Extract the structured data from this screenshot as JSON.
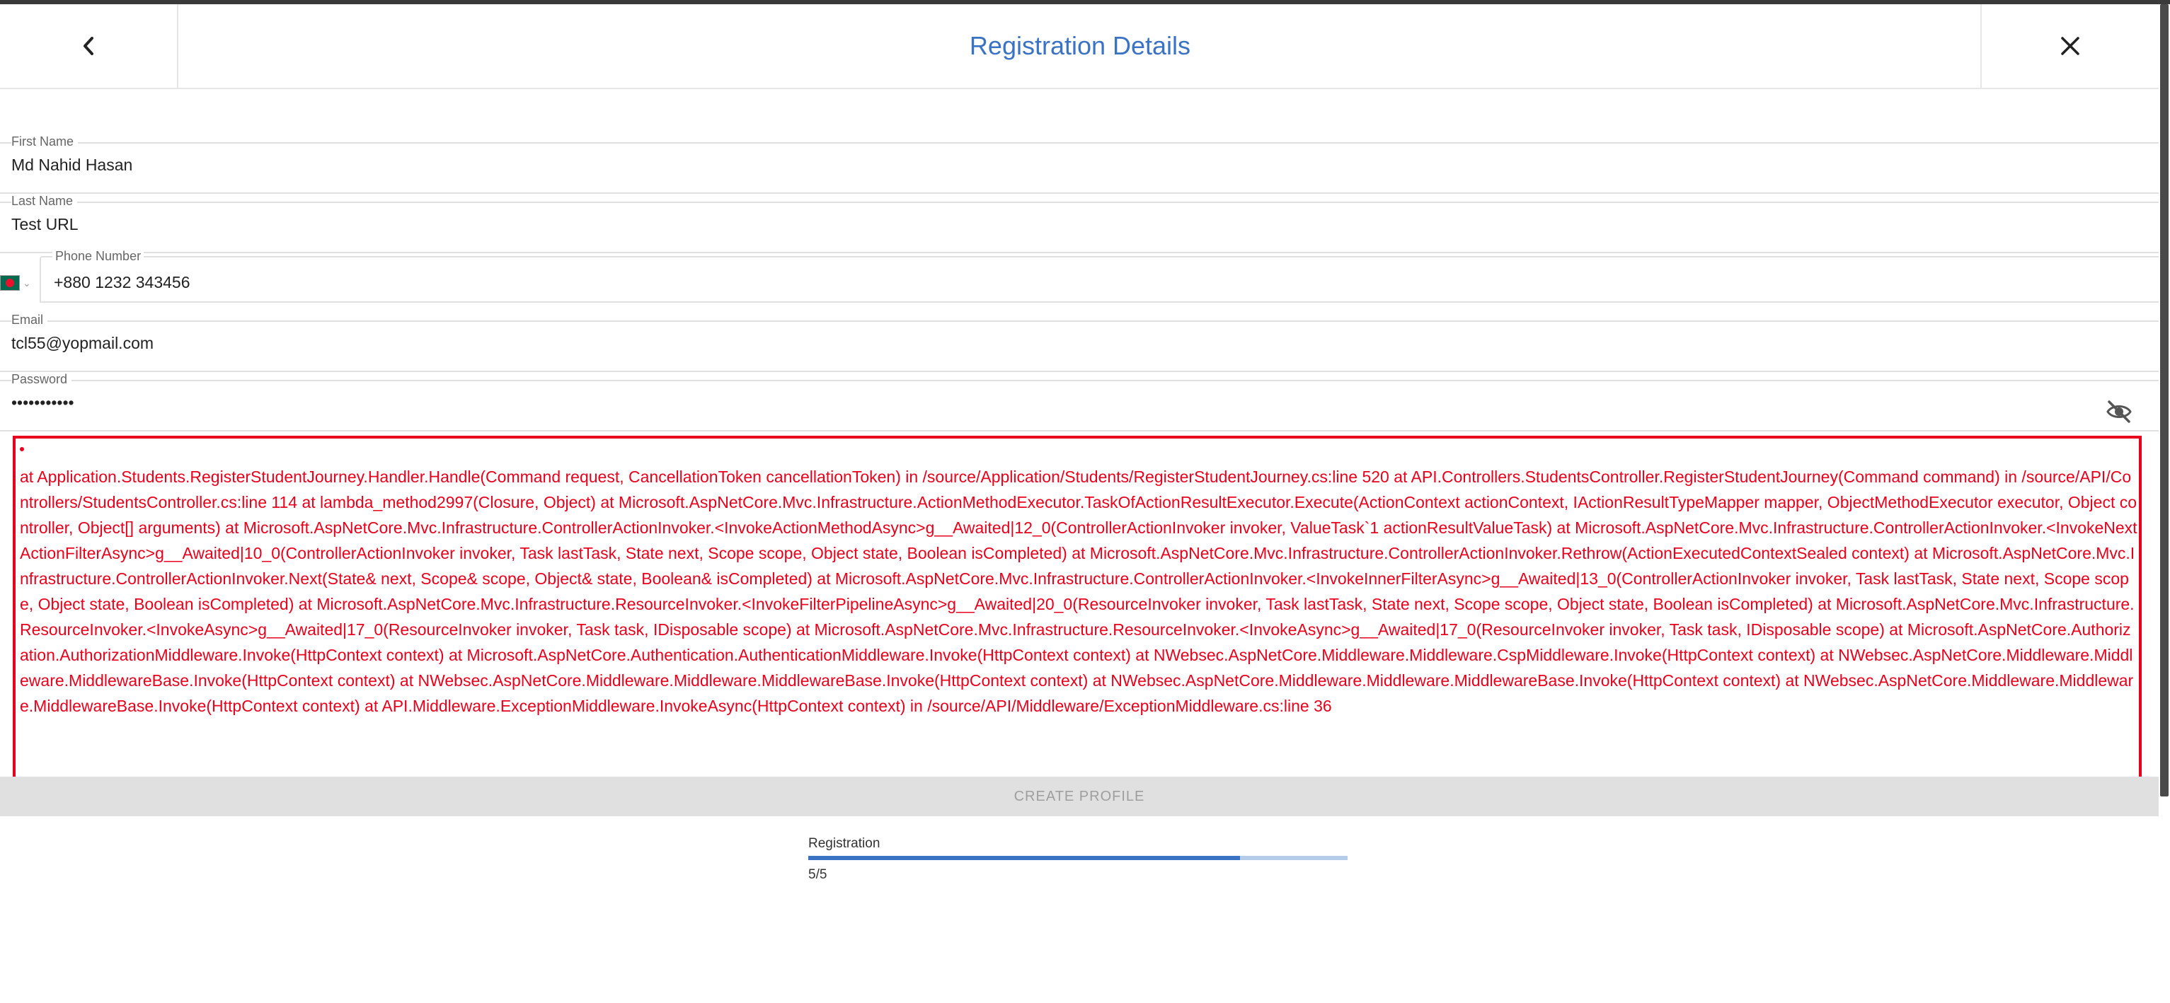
{
  "header": {
    "title": "Registration Details",
    "back_icon": "chevron-left-icon",
    "close_icon": "close-icon"
  },
  "form": {
    "first_name": {
      "label": "First Name",
      "value": "Md Nahid Hasan"
    },
    "last_name": {
      "label": "Last Name",
      "value": "Test URL"
    },
    "phone": {
      "label": "Phone Number",
      "value": "+880 1232 343456",
      "country_flag": "bangladesh-flag-icon"
    },
    "email": {
      "label": "Email",
      "value": "tcl55@yopmail.com"
    },
    "password": {
      "label": "Password",
      "value": "•••••••••••",
      "toggle_icon": "eye-off-icon"
    }
  },
  "error": {
    "bullet": "•",
    "message": "at Application.Students.RegisterStudentJourney.Handler.Handle(Command request, CancellationToken cancellationToken) in /source/Application/Students/RegisterStudentJourney.cs:line 520 at API.Controllers.StudentsController.RegisterStudentJourney(Command command) in /source/API/Controllers/StudentsController.cs:line 114 at lambda_method2997(Closure, Object) at Microsoft.AspNetCore.Mvc.Infrastructure.ActionMethodExecutor.TaskOfActionResultExecutor.Execute(ActionContext actionContext, IActionResultTypeMapper mapper, ObjectMethodExecutor executor, Object controller, Object[] arguments) at Microsoft.AspNetCore.Mvc.Infrastructure.ControllerActionInvoker.<InvokeActionMethodAsync>g__Awaited|12_0(ControllerActionInvoker invoker, ValueTask`1 actionResultValueTask) at Microsoft.AspNetCore.Mvc.Infrastructure.ControllerActionInvoker.<InvokeNextActionFilterAsync>g__Awaited|10_0(ControllerActionInvoker invoker, Task lastTask, State next, Scope scope, Object state, Boolean isCompleted) at Microsoft.AspNetCore.Mvc.Infrastructure.ControllerActionInvoker.Rethrow(ActionExecutedContextSealed context) at Microsoft.AspNetCore.Mvc.Infrastructure.ControllerActionInvoker.Next(State& next, Scope& scope, Object& state, Boolean& isCompleted) at Microsoft.AspNetCore.Mvc.Infrastructure.ControllerActionInvoker.<InvokeInnerFilterAsync>g__Awaited|13_0(ControllerActionInvoker invoker, Task lastTask, State next, Scope scope, Object state, Boolean isCompleted) at Microsoft.AspNetCore.Mvc.Infrastructure.ResourceInvoker.<InvokeFilterPipelineAsync>g__Awaited|20_0(ResourceInvoker invoker, Task lastTask, State next, Scope scope, Object state, Boolean isCompleted) at Microsoft.AspNetCore.Mvc.Infrastructure.ResourceInvoker.<InvokeAsync>g__Awaited|17_0(ResourceInvoker invoker, Task task, IDisposable scope) at Microsoft.AspNetCore.Mvc.Infrastructure.ResourceInvoker.<InvokeAsync>g__Awaited|17_0(ResourceInvoker invoker, Task task, IDisposable scope) at Microsoft.AspNetCore.Authorization.AuthorizationMiddleware.Invoke(HttpContext context) at Microsoft.AspNetCore.Authentication.AuthenticationMiddleware.Invoke(HttpContext context) at NWebsec.AspNetCore.Middleware.Middleware.CspMiddleware.Invoke(HttpContext context) at NWebsec.AspNetCore.Middleware.Middleware.MiddlewareBase.Invoke(HttpContext context) at NWebsec.AspNetCore.Middleware.Middleware.MiddlewareBase.Invoke(HttpContext context) at NWebsec.AspNetCore.Middleware.Middleware.MiddlewareBase.Invoke(HttpContext context) at NWebsec.AspNetCore.Middleware.Middleware.MiddlewareBase.Invoke(HttpContext context) at API.Middleware.ExceptionMiddleware.InvokeAsync(HttpContext context) in /source/API/Middleware/ExceptionMiddleware.cs:line 36",
    "color": "#e8001c"
  },
  "actions": {
    "create_profile_label": "CREATE PROFILE"
  },
  "progress": {
    "label": "Registration",
    "count": "5/5",
    "fill_fraction": 0.8,
    "accent": "#3a73c4"
  }
}
